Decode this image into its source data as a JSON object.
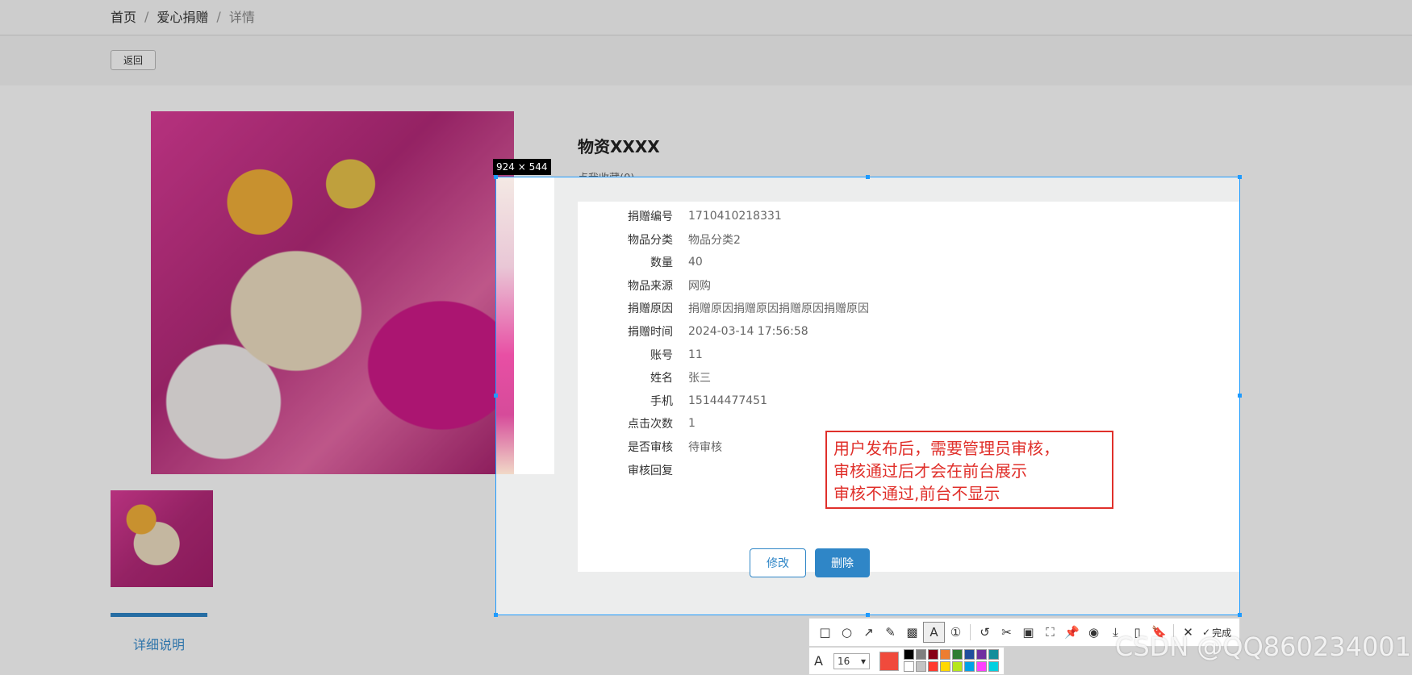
{
  "breadcrumb": {
    "home": "首页",
    "section": "爱心捐赠",
    "current": "详情",
    "separator": "/"
  },
  "actions": {
    "back": "返回"
  },
  "product": {
    "title": "物资XXXX",
    "collect_link": "点我收藏(0)"
  },
  "details": [
    {
      "label": "捐赠编号",
      "value": "1710410218331"
    },
    {
      "label": "物品分类",
      "value": "物品分类2"
    },
    {
      "label": "数量",
      "value": "40"
    },
    {
      "label": "物品来源",
      "value": "网购"
    },
    {
      "label": "捐赠原因",
      "value": "捐赠原因捐赠原因捐赠原因捐赠原因"
    },
    {
      "label": "捐赠时间",
      "value": "2024-03-14 17:56:58"
    },
    {
      "label": "账号",
      "value": "11"
    },
    {
      "label": "姓名",
      "value": "张三"
    },
    {
      "label": "手机",
      "value": "15144477451"
    },
    {
      "label": "点击次数",
      "value": "1"
    },
    {
      "label": "是否审核",
      "value": "待审核"
    },
    {
      "label": "审核回复",
      "value": ""
    }
  ],
  "buttons": {
    "edit": "修改",
    "delete": "删除"
  },
  "tabs": {
    "detail": "详细说明"
  },
  "capture": {
    "size_label": "924 × 544",
    "annotation_lines": [
      "用户发布后，需要管理员审核，",
      "审核通过后才会在前台展示",
      "审核不通过,前台不显示"
    ],
    "done_label": "完成",
    "font_size": "16",
    "current_color": "#f04a3c",
    "palette": [
      "#000000",
      "#7f7f7f",
      "#880015",
      "#ed7d31",
      "#2e7d32",
      "#1f4e9c",
      "#7030a0",
      "#138d9a",
      "#ffffff",
      "#c3c3c3",
      "#ff3b30",
      "#ffd800",
      "#b5e61d",
      "#00a2e8",
      "#ff40ff",
      "#00d0e0"
    ]
  },
  "watermark": "CSDN @QQ860234001"
}
